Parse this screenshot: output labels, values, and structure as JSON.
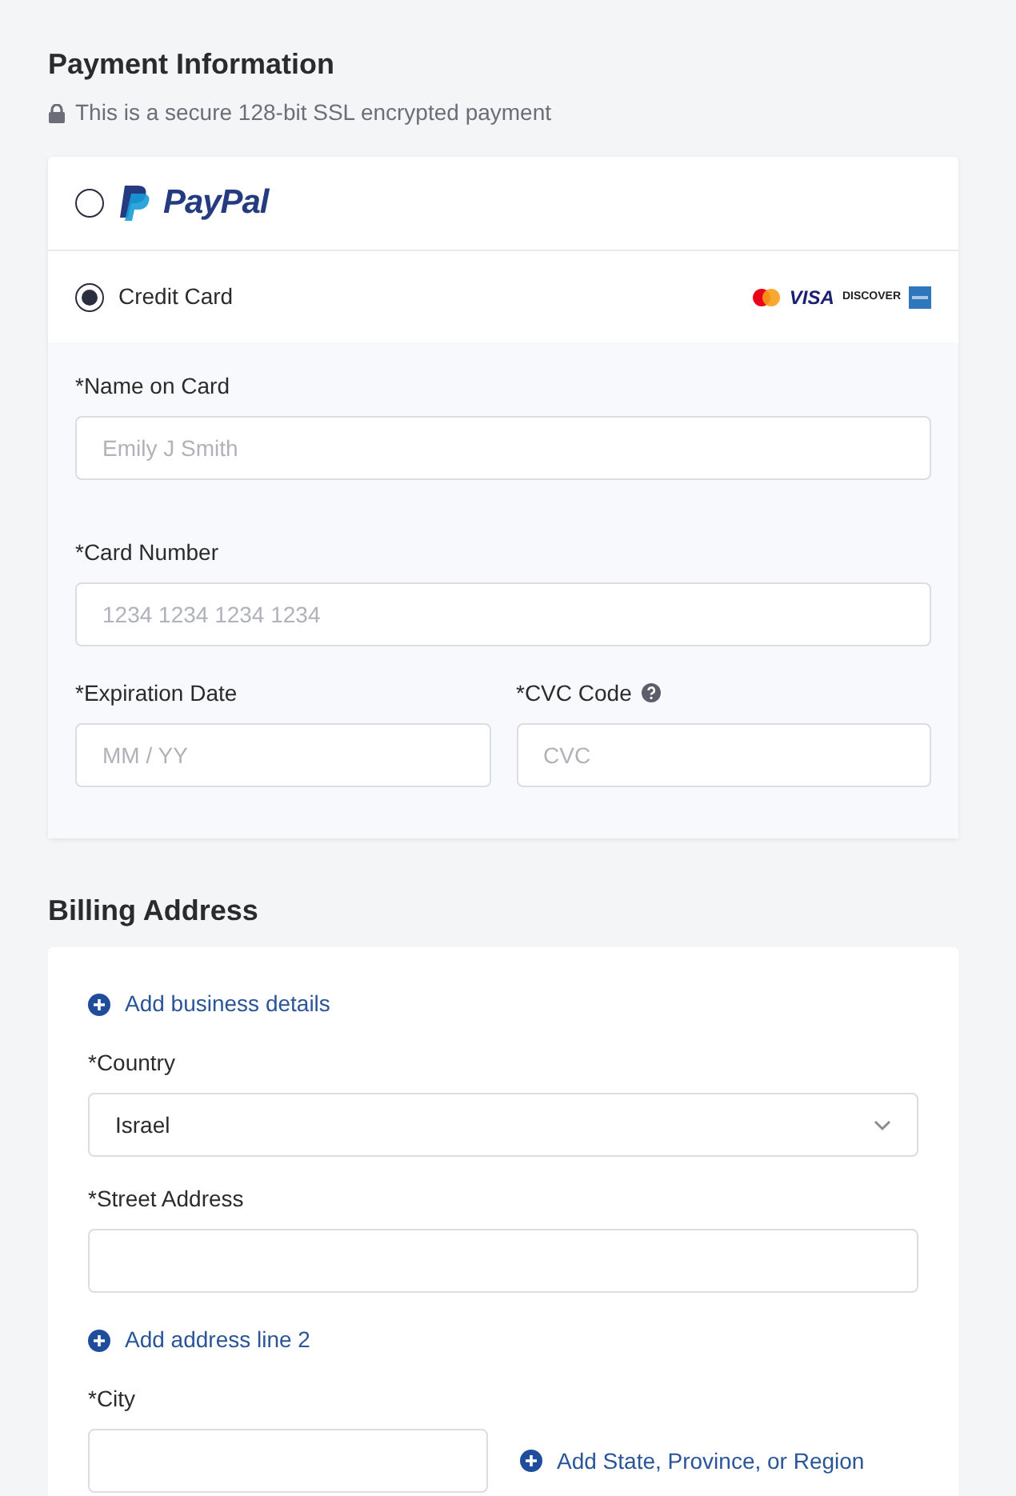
{
  "payment": {
    "title": "Payment Information",
    "secure_note": "This is a secure 128-bit SSL encrypted payment",
    "methods": [
      {
        "kind": "paypal",
        "label": "PayPal",
        "selected": false
      },
      {
        "kind": "card",
        "label": "Credit Card",
        "selected": true,
        "logos": [
          {
            "kind": "mastercard"
          },
          {
            "kind": "visa",
            "text": "VISA"
          },
          {
            "kind": "discover",
            "text": "DISCOVER"
          },
          {
            "kind": "amex"
          }
        ]
      }
    ],
    "fields": [
      {
        "label": "*Name on Card",
        "placeholder": "Emily J Smith"
      },
      {
        "label": "*Card Number",
        "placeholder": "1234 1234 1234 1234"
      },
      {
        "label": "*Expiration Date",
        "placeholder": "MM / YY"
      },
      {
        "label": "*CVC Code",
        "placeholder": "CVC",
        "help": true
      }
    ]
  },
  "billing": {
    "title": "Billing Address",
    "items": [
      {
        "kind": "link",
        "label": "Add business details"
      },
      {
        "kind": "select",
        "label": "*Country",
        "value": "Israel"
      },
      {
        "kind": "input",
        "label": "*Street Address"
      },
      {
        "kind": "link",
        "label": "Add address line 2"
      },
      {
        "kind": "city",
        "label": "*City",
        "link": "Add State, Province, or Region"
      }
    ]
  }
}
